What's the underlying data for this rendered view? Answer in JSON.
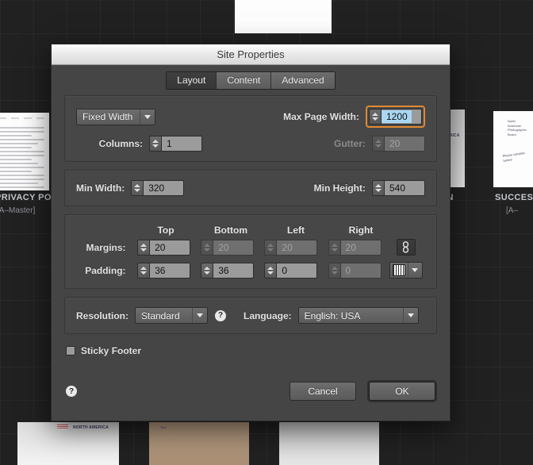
{
  "window": {
    "title": "Site Properties"
  },
  "tabs": [
    {
      "label": "Layout",
      "active": true
    },
    {
      "label": "Content",
      "active": false
    },
    {
      "label": "Advanced",
      "active": false
    }
  ],
  "layout": {
    "width_mode": {
      "label": "Fixed Width"
    },
    "max_page_width": {
      "label": "Max Page Width:",
      "value": "1200",
      "focused": true
    },
    "columns": {
      "label": "Columns:",
      "value": "1"
    },
    "gutter": {
      "label": "Gutter:",
      "value": "20",
      "disabled": true
    },
    "min_width": {
      "label": "Min Width:",
      "value": "320"
    },
    "min_height": {
      "label": "Min Height:",
      "value": "540"
    },
    "box_headers": [
      "Top",
      "Bottom",
      "Left",
      "Right"
    ],
    "margins": {
      "label": "Margins:",
      "top": "20",
      "bottom": "20",
      "left": "20",
      "right": "20",
      "disabled": [
        "bottom",
        "left",
        "right"
      ],
      "link_icon": "chain-link-icon"
    },
    "padding": {
      "label": "Padding:",
      "top": "36",
      "bottom": "36",
      "left": "0",
      "right": "0",
      "disabled": [
        "right"
      ],
      "swatch_icon": "padding-swatch-icon"
    },
    "resolution": {
      "label": "Resolution:",
      "value": "Standard",
      "help_icon": "help-circle-icon"
    },
    "language": {
      "label": "Language:",
      "value": "English: USA"
    },
    "sticky_footer": {
      "label": "Sticky Footer",
      "checked": false
    }
  },
  "footer": {
    "help_icon": "help-circle-icon",
    "cancel": "Cancel",
    "ok": "OK"
  },
  "background": {
    "pages": [
      {
        "label": "PRIVACY POLICY",
        "sublabel": "[A–Master]"
      },
      {
        "label": "IN",
        "sublabel": ""
      },
      {
        "label": "SUCCESS",
        "sublabel": "[A–"
      }
    ],
    "thumb_caption": "NORTH AMERICA",
    "thumb_caption2": "ERICA"
  },
  "colors": {
    "dialog_bg": "#454545",
    "accent_focus": "#e08a32",
    "selection": "#a9d6f2"
  }
}
